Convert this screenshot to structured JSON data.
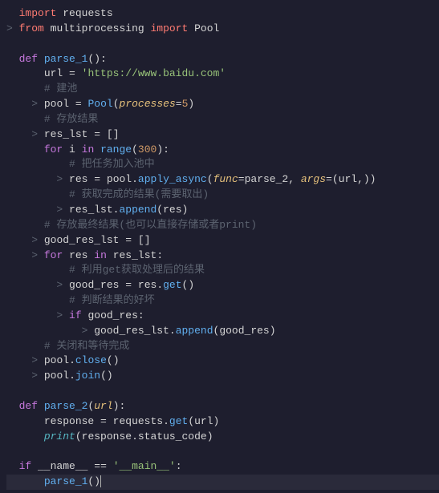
{
  "code": {
    "l1_import": "import",
    "l1_requests": "requests",
    "l2_gutter": ">",
    "l2_from": "from",
    "l2_mp": "multiprocessing",
    "l2_import": "import",
    "l2_pool": "Pool",
    "l4_def": "def",
    "l4_fn": "parse_1",
    "l5_url": "url",
    "l5_eq": "=",
    "l5_str": "'https://www.baidu.com'",
    "l6_comment": "# 建池",
    "l7_gutter": ">",
    "l7_pool": "pool",
    "l7_eq": "=",
    "l7_Pool": "Pool",
    "l7_param": "processes",
    "l7_eq2": "=",
    "l7_num": "5",
    "l8_comment": "# 存放结果",
    "l9_gutter": ">",
    "l9_reslst": "res_lst",
    "l9_eq": "=",
    "l10_for": "for",
    "l10_i": "i",
    "l10_in": "in",
    "l10_range": "range",
    "l10_num": "300",
    "l11_comment": "# 把任务加入池中",
    "l12_gutter": ">",
    "l12_res": "res",
    "l12_eq": "=",
    "l12_pool": "pool",
    "l12_apply": "apply_async",
    "l12_func": "func",
    "l12_parse2": "parse_2",
    "l12_args": "args",
    "l12_url": "url",
    "l13_comment": "# 获取完成的结果(需要取出)",
    "l14_gutter": ">",
    "l14_reslst": "res_lst",
    "l14_append": "append",
    "l14_res": "res",
    "l15_comment": "# 存放最终结果(也可以直接存储或者print)",
    "l16_gutter": ">",
    "l16_goodreslst": "good_res_lst",
    "l16_eq": "=",
    "l17_gutter": ">",
    "l17_for": "for",
    "l17_res": "res",
    "l17_in": "in",
    "l17_reslst": "res_lst",
    "l18_comment": "# 利用get获取处理后的结果",
    "l19_gutter": ">",
    "l19_goodres": "good_res",
    "l19_eq": "=",
    "l19_res": "res",
    "l19_get": "get",
    "l20_comment": "# 判断结果的好坏",
    "l21_gutter": ">",
    "l21_if": "if",
    "l21_goodres": "good_res",
    "l22_gutter": ">",
    "l22_goodreslst": "good_res_lst",
    "l22_append": "append",
    "l22_goodres": "good_res",
    "l23_comment": "# 关闭和等待完成",
    "l24_gutter": ">",
    "l24_pool": "pool",
    "l24_close": "close",
    "l25_gutter": ">",
    "l25_pool": "pool",
    "l25_join": "join",
    "l27_def": "def",
    "l27_fn": "parse_2",
    "l27_param": "url",
    "l28_response": "response",
    "l28_eq": "=",
    "l28_requests": "requests",
    "l28_get": "get",
    "l28_url": "url",
    "l29_print": "print",
    "l29_response": "response",
    "l29_status": "status_code",
    "l31_if": "if",
    "l31_name": "__name__",
    "l31_eq": "==",
    "l31_main": "'__main__'",
    "l32_parse1": "parse_1"
  }
}
